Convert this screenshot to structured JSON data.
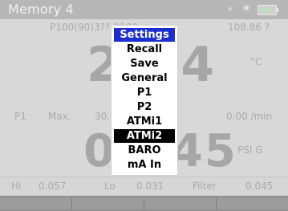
{
  "window": {
    "title": "Memory 4"
  },
  "status": {
    "usb_icon": "usb-icon",
    "sun_icon": "sun-icon",
    "battery_icon": "battery-icon"
  },
  "top_panel": {
    "header": "P100(90)3??-0100",
    "header_right": "108.86 ?",
    "reading": "2??4",
    "unit": "°C"
  },
  "mid_panel": {
    "channel": "P1",
    "mode": "Max.",
    "rate_left": "30.",
    "rate": "0.00 /min",
    "reading": "0??45",
    "unit": "PSI G"
  },
  "stats": {
    "hi_label": "Hi",
    "hi_value": "0.057",
    "lo_label": "Lo",
    "lo_value": "0.031",
    "filter_label": "Filter",
    "filter_value": "0.045"
  },
  "menu": {
    "title": "Settings",
    "items": [
      "Recall",
      "Save",
      "General",
      "P1",
      "P2",
      "ATMi1",
      "ATMi2",
      "BARO",
      "mA In"
    ],
    "selected": "ATMi2"
  },
  "colors": {
    "menu_title_bg": "#1b2fd0",
    "selected_bg": "#000000",
    "screen_bg": "#d8d8d8"
  }
}
